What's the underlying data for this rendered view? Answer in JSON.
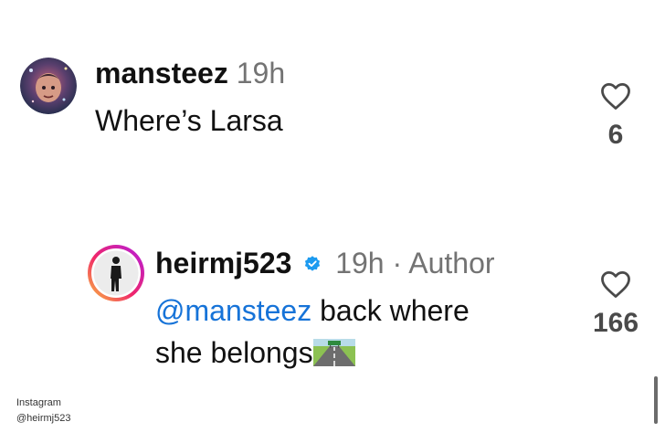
{
  "comments": [
    {
      "username": "mansteez",
      "time": "19h",
      "text": "Where’s Larsa",
      "like_count": "6",
      "avatar_icon": "cartoon-avatar"
    }
  ],
  "reply": {
    "username": "heirmj523",
    "verified": true,
    "time_author": "19h · Author",
    "mention": "@mansteez",
    "text_after_mention": " back where",
    "text_line2": "she belongs",
    "emoji": "motorway-emoji",
    "like_count": "166",
    "avatar_icon": "story-ring-avatar"
  },
  "watermark": {
    "line1": "Instagram",
    "line2": "@heirmj523"
  },
  "colors": {
    "mention": "#1673d8",
    "verified": "#1d9bf0",
    "meta": "#737373"
  }
}
